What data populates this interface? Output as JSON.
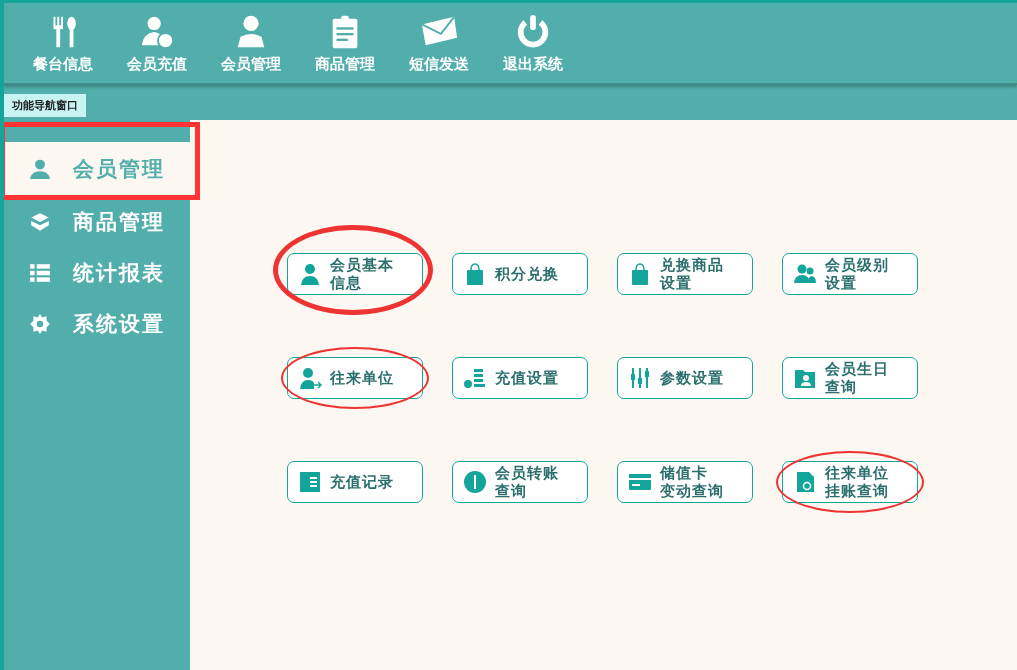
{
  "toolbar": [
    {
      "label": "餐台信息"
    },
    {
      "label": "会员充值"
    },
    {
      "label": "会员管理"
    },
    {
      "label": "商品管理"
    },
    {
      "label": "短信发送"
    },
    {
      "label": "退出系统"
    }
  ],
  "tabs": [
    {
      "label": "功能导航窗口",
      "selected": true
    }
  ],
  "sidebar": {
    "items": [
      {
        "label": "会员管理",
        "selected": true,
        "boxed": true
      },
      {
        "label": "商品管理",
        "selected": false,
        "boxed": false
      },
      {
        "label": "统计报表",
        "selected": false,
        "boxed": false
      },
      {
        "label": "系统设置",
        "selected": false,
        "boxed": false
      }
    ]
  },
  "buttons": [
    {
      "lines": [
        "会员基本",
        "信息"
      ],
      "circled": true
    },
    {
      "lines": [
        "积分兑换"
      ],
      "circled": false
    },
    {
      "lines": [
        "兑换商品",
        "设置"
      ],
      "circled": false
    },
    {
      "lines": [
        "会员级别",
        "设置"
      ],
      "circled": false
    },
    {
      "lines": [
        "往来单位"
      ],
      "circled": true
    },
    {
      "lines": [
        "充值设置"
      ],
      "circled": false
    },
    {
      "lines": [
        "参数设置"
      ],
      "circled": false
    },
    {
      "lines": [
        "会员生日",
        "查询"
      ],
      "circled": false
    },
    {
      "lines": [
        "充值记录"
      ],
      "circled": false
    },
    {
      "lines": [
        "会员转账",
        "查询"
      ],
      "circled": false
    },
    {
      "lines": [
        "储值卡",
        "变动查询"
      ],
      "circled": false
    },
    {
      "lines": [
        "往来单位",
        "挂账查询"
      ],
      "circled": true
    }
  ]
}
